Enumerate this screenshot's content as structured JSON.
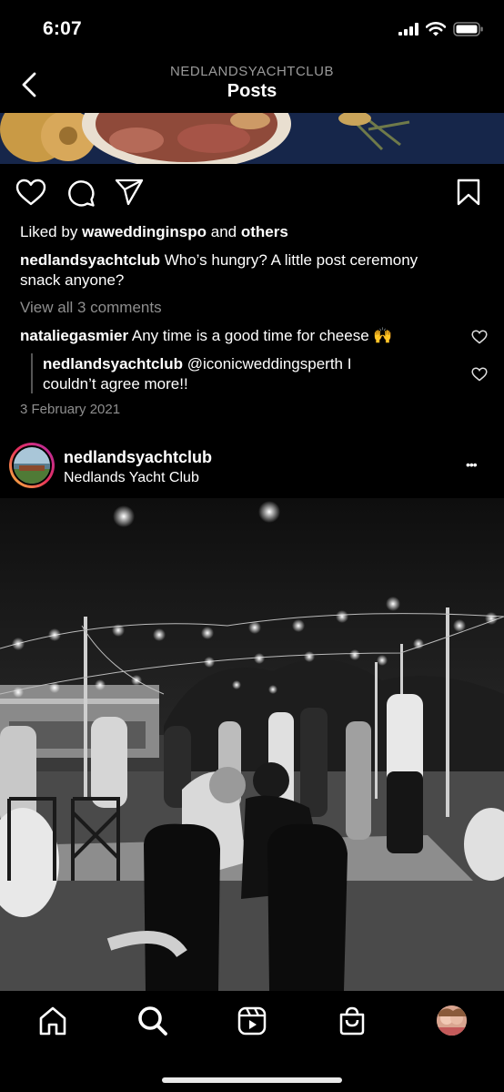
{
  "status": {
    "time": "6:07"
  },
  "header": {
    "username": "NEDLANDSYACHTCLUB",
    "title": "Posts"
  },
  "post1": {
    "liked_prefix": "Liked by",
    "liked_user": "waweddinginspo",
    "liked_and": "and",
    "liked_others": "others",
    "caption_user": "nedlandsyachtclub",
    "caption_line1": "Who’s hungry? A little post ceremony",
    "caption_line2": "snack anyone?",
    "view_comments": "View all 3 comments",
    "comment1_user": "nataliegasmier",
    "comment1_text": "Any time is a good time for cheese 🙌",
    "reply_user": "nedlandsyachtclub",
    "reply_line1": "@iconicweddingsperth I",
    "reply_line2": "couldn’t agree more!!",
    "date": "3 February 2021"
  },
  "post2": {
    "username": "nedlandsyachtclub",
    "location": "Nedlands Yacht Club",
    "more": "•••"
  },
  "icons": {
    "back": "chevron-left-icon",
    "like": "heart-icon",
    "comment": "comment-icon",
    "share": "paper-plane-icon",
    "save": "bookmark-icon",
    "home": "home-icon",
    "search": "search-icon",
    "reels": "reels-icon",
    "shop": "shopping-bag-icon"
  }
}
